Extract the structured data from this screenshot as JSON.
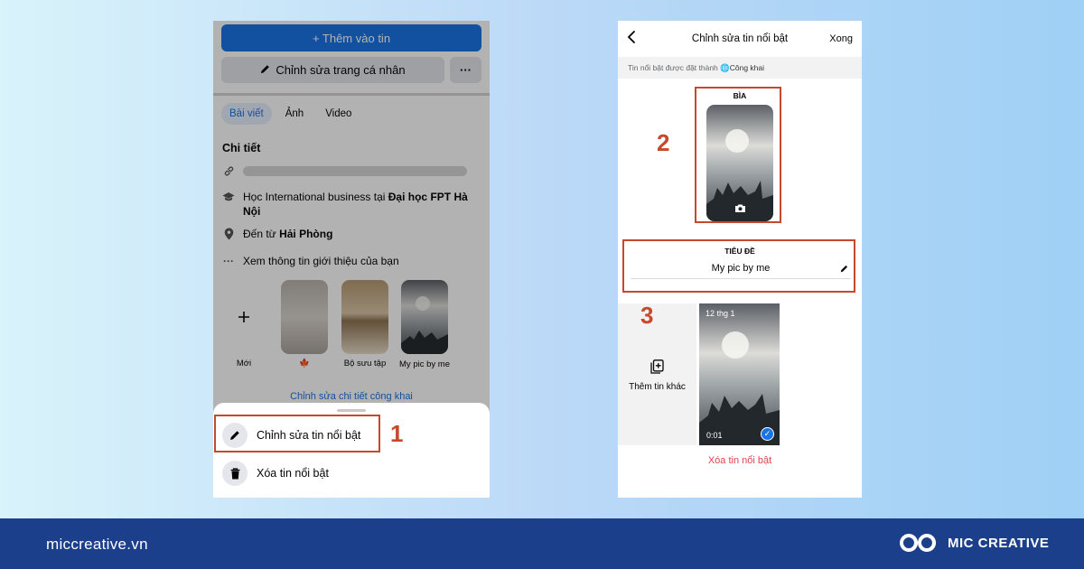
{
  "left_phone": {
    "add_story_button": "+ Thêm vào tin",
    "edit_profile_button": "Chỉnh sửa trang cá nhân",
    "more_button": "···",
    "tabs": [
      "Bài viết",
      "Ảnh",
      "Video"
    ],
    "details_title": "Chi tiết",
    "education": {
      "prefix": "Học International business tại ",
      "school": "Đại học FPT Hà Nội"
    },
    "hometown": {
      "prefix": "Đến từ ",
      "city": "Hải Phòng"
    },
    "see_about": "Xem thông tin giới thiệu của bạn",
    "highlights": [
      {
        "label": "Mới"
      },
      {
        "label": "🍁"
      },
      {
        "label": "Bộ sưu tập"
      },
      {
        "label": "My pic by me"
      }
    ],
    "edit_public_details": "Chỉnh sửa chi tiết công khai",
    "sheet": {
      "edit_highlight": "Chỉnh sửa tin nổi bật",
      "delete_highlight": "Xóa tin nổi bật"
    }
  },
  "right_phone": {
    "header_title": "Chỉnh sửa tin nổi bật",
    "done_button": "Xong",
    "privacy_prefix": "Tin nổi bật được đặt thành ",
    "privacy_value": "Công khai",
    "cover_label": "BÌA",
    "title_label": "TIÊU ĐỀ",
    "title_value": "My pic by me",
    "add_more_label": "Thêm tin khác",
    "story_date": "12 thg 1",
    "story_duration": "0:01",
    "delete_link": "Xóa tin nổi bật"
  },
  "annotations": {
    "step1": "1",
    "step2": "2",
    "step3": "3"
  },
  "footer": {
    "site": "miccreative.vn",
    "brand": "MIC CREATIVE"
  },
  "colors": {
    "accent_blue": "#1b74e4",
    "annotation_red": "#c6492c",
    "footer_bg": "#1b3f8b",
    "delete_red": "#e0434a"
  }
}
